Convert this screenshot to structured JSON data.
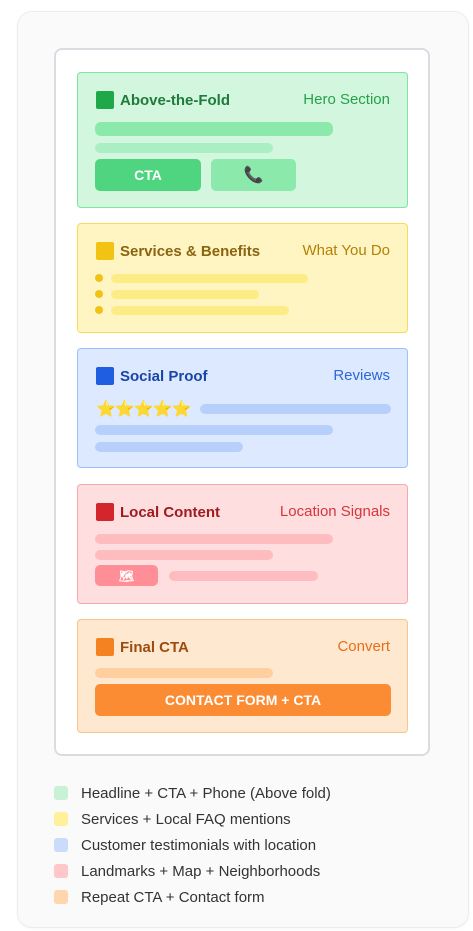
{
  "sections": [
    {
      "title": "Above-the-Fold",
      "tag": "Hero Section",
      "cta": "CTA",
      "phone_icon": "phone-icon",
      "colors": {
        "bg": "#d3f6de",
        "border": "#7fe3a1",
        "square": "#1ea84a",
        "text": "#1f7a3b",
        "tag": "#25a24a",
        "bar": "#8ae9ab",
        "btn": "#4fd47f"
      }
    },
    {
      "title": "Services & Benefits",
      "tag": "What You Do",
      "colors": {
        "bg": "#fff5c2",
        "border": "#f7dc5c",
        "square": "#f2c315",
        "text": "#8a6410",
        "tag": "#b48008",
        "bar": "#fdec84",
        "dot": "#f2c315"
      }
    },
    {
      "title": "Social Proof",
      "tag": "Reviews",
      "stars": "⭐⭐⭐⭐⭐",
      "colors": {
        "bg": "#dde9ff",
        "border": "#9ec0f9",
        "square": "#1f5ee0",
        "text": "#1845a8",
        "tag": "#2d67d9",
        "bar": "#b7d0fb"
      }
    },
    {
      "title": "Local Content",
      "tag": "Location Signals",
      "map_icon": "map-icon",
      "colors": {
        "bg": "#ffdedf",
        "border": "#f5a9ac",
        "square": "#d3262c",
        "text": "#9f1b20",
        "tag": "#d6363b",
        "bar": "#ffbcc0",
        "badge": "#ff8e96"
      }
    },
    {
      "title": "Final CTA",
      "tag": "Convert",
      "form_label": "CONTACT FORM + CTA",
      "colors": {
        "bg": "#ffe8d0",
        "border": "#fbc48a",
        "square": "#f58220",
        "text": "#9b4d10",
        "tag": "#ea6e15",
        "bar": "#ffcf9f",
        "btn": "#fb8c34"
      }
    }
  ],
  "legend": [
    {
      "label": "Headline + CTA + Phone (Above fold)",
      "color": "#c9f1d6"
    },
    {
      "label": "Services + Local FAQ mentions",
      "color": "#fff19b"
    },
    {
      "label": "Customer testimonials with location",
      "color": "#c9dcfb"
    },
    {
      "label": "Landmarks + Map + Neighborhoods",
      "color": "#ffc7ca"
    },
    {
      "label": "Repeat CTA + Contact form",
      "color": "#ffd6ad"
    }
  ]
}
